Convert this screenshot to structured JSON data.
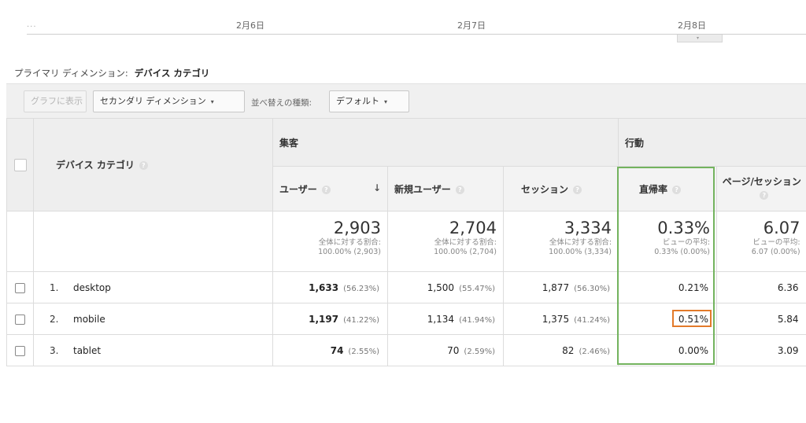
{
  "timeline": {
    "ellipsis": "...",
    "dates": [
      "2月6日",
      "2月7日",
      "2月8日"
    ],
    "handle_icon": "▾"
  },
  "primary_dimension": {
    "label": "プライマリ ディメンション:",
    "value": "デバイス カテゴリ"
  },
  "toolbar": {
    "chart_button": "グラフに表示",
    "secondary_dimension": "セカンダリ ディメンション",
    "sort_label": "並べ替えの種類:",
    "sort_value": "デフォルト",
    "caret": "▾"
  },
  "table": {
    "dimension_header": "デバイス カテゴリ",
    "groups": {
      "acquisition": "集客",
      "behavior": "行動"
    },
    "columns": {
      "users": "ユーザー",
      "new_users": "新規ユーザー",
      "sessions": "セッション",
      "bounce_rate": "直帰率",
      "pages_per_session": "ページ/セッション"
    },
    "help_icon": "?",
    "sort_arrow": "↓",
    "totals": {
      "users": {
        "value": "2,903",
        "line1": "全体に対する割合:",
        "line2": "100.00% (2,903)"
      },
      "new_users": {
        "value": "2,704",
        "line1": "全体に対する割合:",
        "line2": "100.00% (2,704)"
      },
      "sessions": {
        "value": "3,334",
        "line1": "全体に対する割合:",
        "line2": "100.00% (3,334)"
      },
      "bounce_rate": {
        "value": "0.33%",
        "line1": "ビューの平均:",
        "line2": "0.33% (0.00%)"
      },
      "pages_per_session": {
        "value": "6.07",
        "line1": "ビューの平均:",
        "line2": "6.07 (0.00%)"
      }
    },
    "rows": [
      {
        "index": "1.",
        "device": "desktop",
        "users": "1,633",
        "users_pct": "(56.23%)",
        "new_users": "1,500",
        "new_users_pct": "(55.47%)",
        "sessions": "1,877",
        "sessions_pct": "(56.30%)",
        "bounce_rate": "0.21%",
        "pages_per_session": "6.36"
      },
      {
        "index": "2.",
        "device": "mobile",
        "users": "1,197",
        "users_pct": "(41.22%)",
        "new_users": "1,134",
        "new_users_pct": "(41.94%)",
        "sessions": "1,375",
        "sessions_pct": "(41.24%)",
        "bounce_rate": "0.51%",
        "pages_per_session": "5.84"
      },
      {
        "index": "3.",
        "device": "tablet",
        "users": "74",
        "users_pct": "(2.55%)",
        "new_users": "70",
        "new_users_pct": "(2.59%)",
        "sessions": "82",
        "sessions_pct": "(2.46%)",
        "bounce_rate": "0.00%",
        "pages_per_session": "3.09"
      }
    ]
  },
  "highlight_colors": {
    "bounce_column": "#73b35e",
    "mobile_bounce": "#e37a2a"
  }
}
